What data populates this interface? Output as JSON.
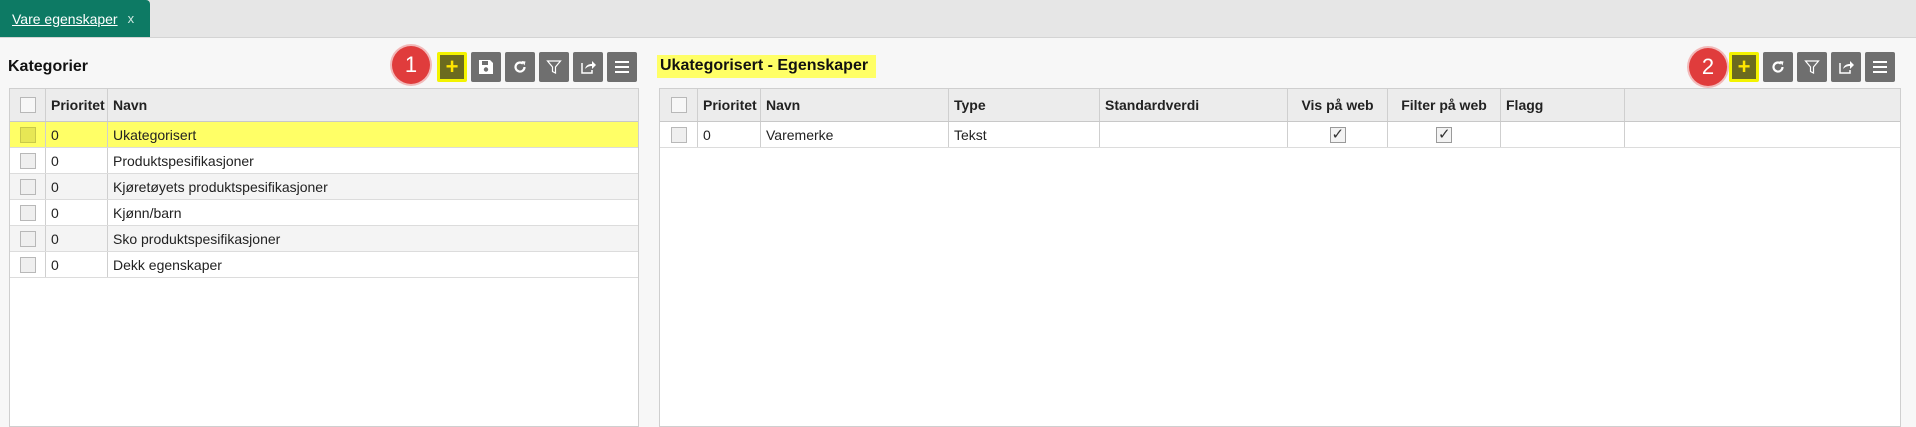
{
  "tab": {
    "label": "Vare egenskaper",
    "close": "x"
  },
  "left": {
    "title": "Kategorier",
    "callout": "1",
    "columns": [
      "Prioritet",
      "Navn"
    ],
    "rows": [
      {
        "prioritet": "0",
        "navn": "Ukategorisert",
        "selected": true
      },
      {
        "prioritet": "0",
        "navn": "Produktspesifikasjoner"
      },
      {
        "prioritet": "0",
        "navn": "Kjøretøyets produktspesifikasjoner"
      },
      {
        "prioritet": "0",
        "navn": "Kjønn/barn"
      },
      {
        "prioritet": "0",
        "navn": "Sko produktspesifikasjoner"
      },
      {
        "prioritet": "0",
        "navn": "Dekk egenskaper"
      }
    ],
    "toolbar_icons": [
      "plus-icon",
      "save-icon",
      "refresh-icon",
      "filter-icon",
      "export-icon",
      "menu-icon"
    ]
  },
  "right": {
    "title": "Ukategorisert - Egenskaper",
    "callout": "2",
    "columns": [
      "Prioritet",
      "Navn",
      "Type",
      "Standardverdi",
      "Vis på web",
      "Filter på web",
      "Flagg"
    ],
    "rows": [
      {
        "prioritet": "0",
        "navn": "Varemerke",
        "type": "Tekst",
        "standardverdi": "",
        "vis_pa_web": true,
        "filter_pa_web": true,
        "flagg": ""
      }
    ],
    "toolbar_icons": [
      "plus-icon",
      "refresh-icon",
      "filter-icon",
      "export-icon",
      "menu-icon"
    ]
  },
  "colors": {
    "tab": "#0d7a64",
    "highlight": "#ffff66",
    "callout": "#e03c3c",
    "toolbar": "#6f6f6f"
  }
}
